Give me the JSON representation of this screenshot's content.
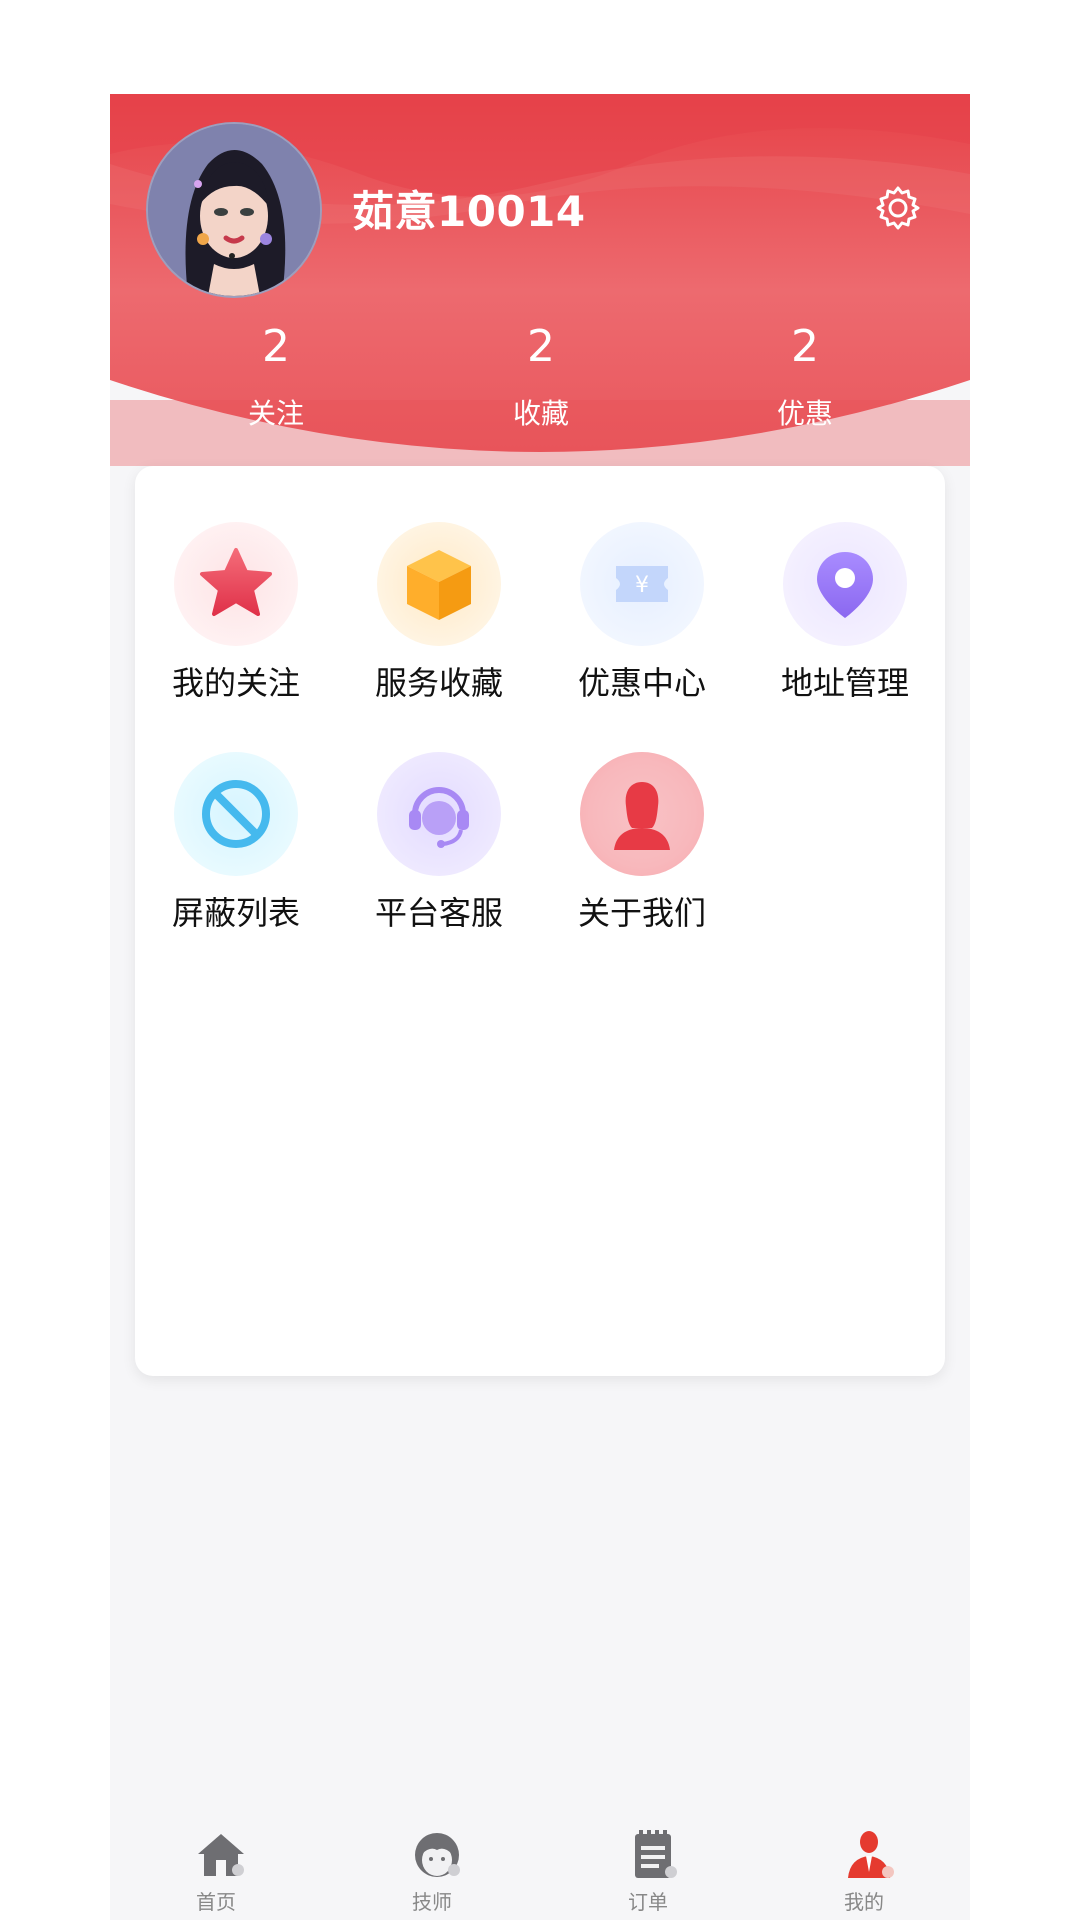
{
  "profile": {
    "username": "茹意10014"
  },
  "stats": [
    {
      "value": "2",
      "label": "关注"
    },
    {
      "value": "2",
      "label": "收藏"
    },
    {
      "value": "2",
      "label": "优惠"
    }
  ],
  "menu": [
    {
      "label": "我的关注",
      "icon": "star-icon"
    },
    {
      "label": "服务收藏",
      "icon": "box-icon"
    },
    {
      "label": "优惠中心",
      "icon": "coupon-icon"
    },
    {
      "label": "地址管理",
      "icon": "location-pin-icon"
    },
    {
      "label": "屏蔽列表",
      "icon": "block-icon"
    },
    {
      "label": "平台客服",
      "icon": "headset-icon"
    },
    {
      "label": "关于我们",
      "icon": "person-icon"
    }
  ],
  "tabs": [
    {
      "label": "首页",
      "icon": "home-icon"
    },
    {
      "label": "技师",
      "icon": "technician-icon"
    },
    {
      "label": "订单",
      "icon": "order-icon"
    },
    {
      "label": "我的",
      "icon": "me-icon",
      "active": true
    }
  ],
  "colors": {
    "accent": "#e8454c",
    "hero_light": "#ef6f73",
    "background": "#f6f6f8"
  }
}
